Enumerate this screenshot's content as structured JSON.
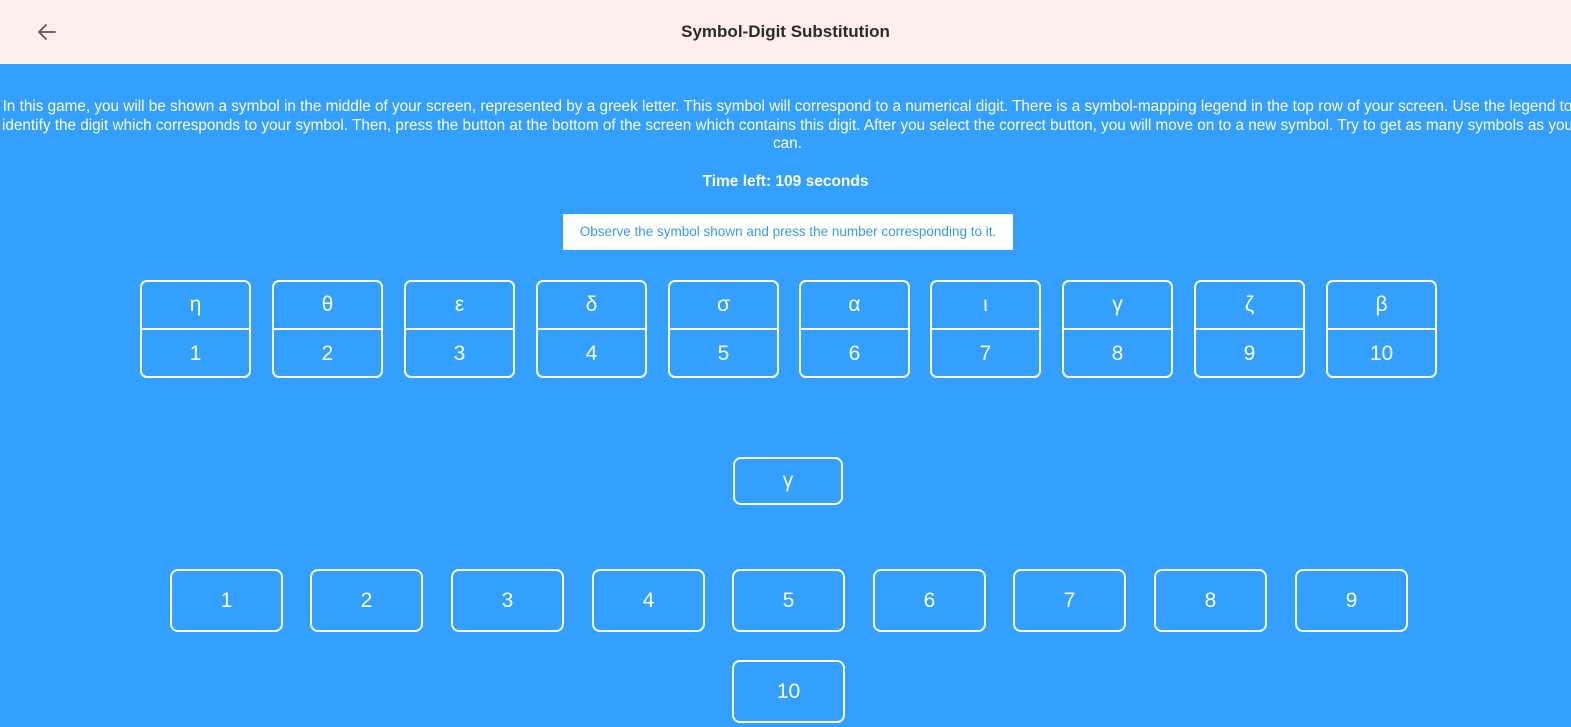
{
  "header": {
    "title": "Symbol-Digit Substitution",
    "back_icon": "arrow-left-icon"
  },
  "instructions": "In this game, you will be shown a symbol in the middle of your screen, represented by a greek letter. This symbol will correspond to a numerical digit. There is a symbol-mapping legend in the top row of your screen. Use the legend to identify the digit which corresponds to your symbol. Then, press the button at the bottom of the screen which contains this digit. After you select the correct button, you will move on to a new symbol. Try to get as many symbols as you can.",
  "timer": "Time left: 109 seconds",
  "hint": "Observe the symbol shown and press the number corresponding to it.",
  "legend": [
    {
      "symbol": "η",
      "digit": "1"
    },
    {
      "symbol": "θ",
      "digit": "2"
    },
    {
      "symbol": "ε",
      "digit": "3"
    },
    {
      "symbol": "δ",
      "digit": "4"
    },
    {
      "symbol": "σ",
      "digit": "5"
    },
    {
      "symbol": "α",
      "digit": "6"
    },
    {
      "symbol": "ι",
      "digit": "7"
    },
    {
      "symbol": "γ",
      "digit": "8"
    },
    {
      "symbol": "ζ",
      "digit": "9"
    },
    {
      "symbol": "β",
      "digit": "10"
    }
  ],
  "current_symbol": "γ",
  "answers": [
    "1",
    "2",
    "3",
    "4",
    "5",
    "6",
    "7",
    "8",
    "9",
    "10"
  ],
  "colors": {
    "background": "#339ffe",
    "header": "#fdf0ec",
    "hint_text": "#3a9be0"
  }
}
